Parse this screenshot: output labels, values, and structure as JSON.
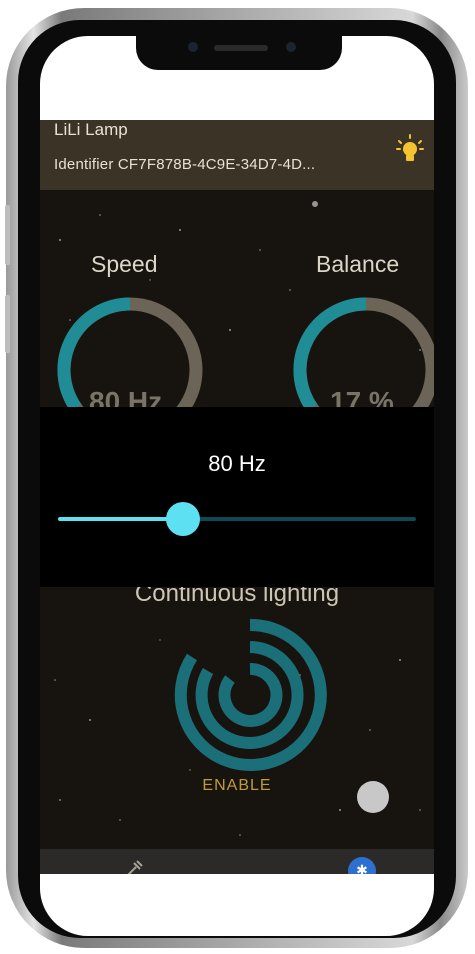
{
  "device": {
    "name": "LiLi Lamp",
    "identifier": "Identifier CF7F878B-4C9E-34D7-4D..."
  },
  "gauges": {
    "speed": {
      "label": "Speed",
      "value": "80 Hz",
      "fraction": 0.55
    },
    "balance": {
      "label": "Balance",
      "value": "17 %",
      "fraction": 0.55
    }
  },
  "slider": {
    "value": "80 Hz",
    "fraction": 0.35
  },
  "mode": {
    "title": "Continuous lighting",
    "enable_label": "ENABLE"
  },
  "icons": {
    "bulb": "lightbulb-icon",
    "mode": "concentric-rings-icon",
    "tab_left": "wrench-icon",
    "tab_right": "bluetooth-icon"
  },
  "colors": {
    "accent": "#1f8c96",
    "slider": "#5ee0f3",
    "enable": "#c19a3a",
    "header": "#3a3326"
  }
}
